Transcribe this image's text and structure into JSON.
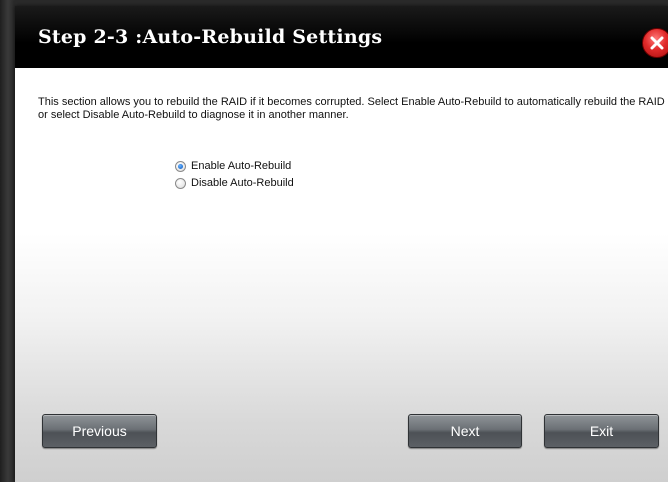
{
  "dialog": {
    "title": "Step 2-3 :Auto-Rebuild Settings",
    "description": "This section allows you to rebuild the RAID if it becomes corrupted. Select Enable Auto-Rebuild to automatically rebuild the RAID or select Disable Auto-Rebuild to diagnose it in another manner.",
    "options": [
      {
        "label": "Enable Auto-Rebuild",
        "selected": true
      },
      {
        "label": "Disable Auto-Rebuild",
        "selected": false
      }
    ],
    "buttons": {
      "previous": "Previous",
      "next": "Next",
      "exit": "Exit"
    },
    "icons": {
      "close": "close-icon"
    }
  },
  "colors": {
    "titlebar": "#000000",
    "close_button": "#e12a2a",
    "button": "#6b7075",
    "radio_selected": "#1f6fd1"
  }
}
